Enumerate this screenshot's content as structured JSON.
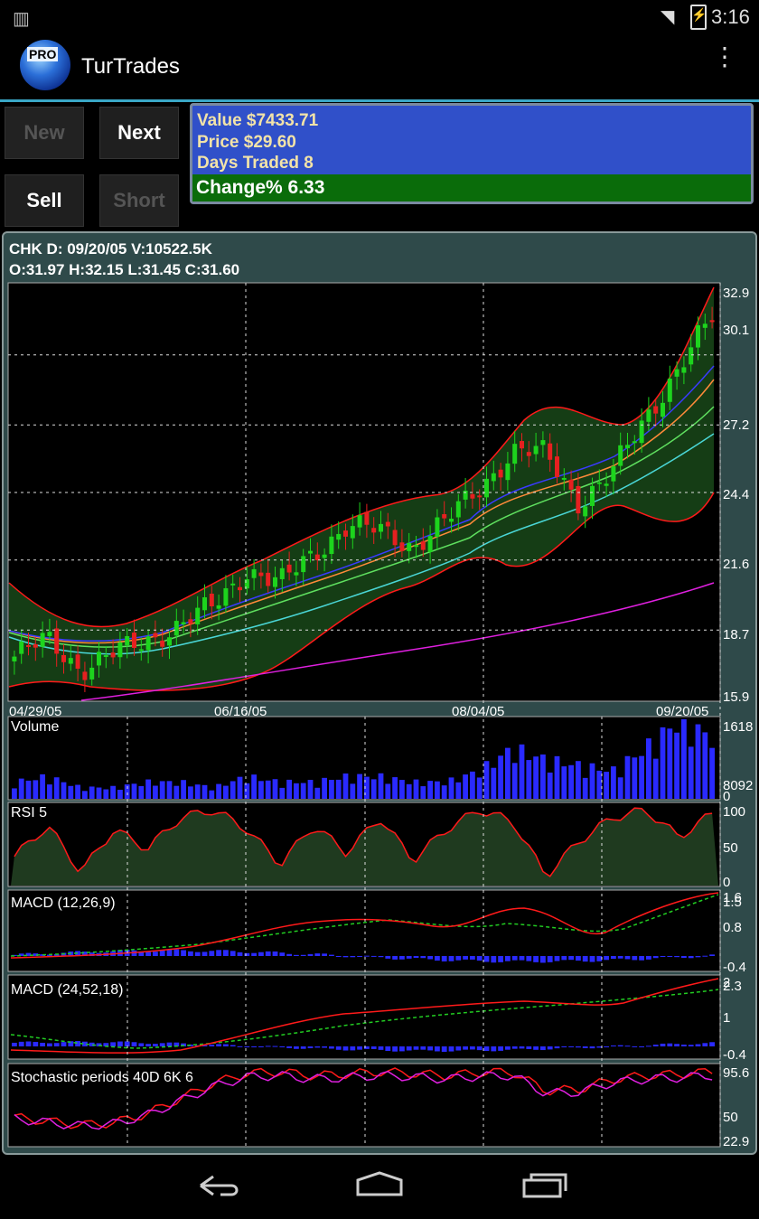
{
  "status_bar": {
    "time": "3:16"
  },
  "action_bar": {
    "title": "TurTrades",
    "logo_text": "PRO"
  },
  "buttons": {
    "new": "New",
    "next": "Next",
    "sell": "Sell",
    "short": "Short"
  },
  "info": {
    "value": "Value  $7433.71",
    "price": "Price   $29.60",
    "days": "Days Traded 8",
    "change": "Change% 6.33"
  },
  "quote": {
    "line1": "CHK D: 09/20/05 V:10522.5K",
    "line2": "O:31.97 H:32.15 L:31.45 C:31.60"
  },
  "panels": {
    "price": {
      "yticks": [
        "32.9",
        "30.1",
        "27.2",
        "24.4",
        "21.6",
        "18.7",
        "15.9"
      ],
      "xticks": [
        "04/29/05",
        "06/16/05",
        "08/04/05",
        "09/20/05"
      ]
    },
    "volume": {
      "label": "Volume",
      "yticks": [
        "1618",
        "8092",
        "0"
      ]
    },
    "rsi": {
      "label": "RSI 5",
      "yticks": [
        "100",
        "50",
        "0"
      ]
    },
    "macd1": {
      "label": "MACD (12,26,9)",
      "yticks": [
        "1.6",
        "1.5",
        "0.8",
        "-0.4"
      ]
    },
    "macd2": {
      "label": "MACD (24,52,18)",
      "yticks": [
        "2",
        "2.3",
        "1",
        "-0.4"
      ]
    },
    "stoch": {
      "label": "Stochastic periods 40D 6K 6",
      "yticks": [
        "95.6",
        "50",
        "22.9"
      ]
    }
  },
  "colors": {
    "up": "#1dd41d",
    "down": "#e62020",
    "bollinger": "#ff1a1a",
    "ma_long": "#e020e0",
    "volume": "#2a2aff",
    "macd_signal": "#22cc22"
  },
  "chart_data": {
    "type": "candlestick",
    "title": "CHK D: 09/20/05 V:10522.5K",
    "x_range": [
      "04/29/05",
      "09/20/05"
    ],
    "ylim": [
      15.9,
      32.9
    ],
    "close_trend": [
      {
        "x": "04/29/05",
        "y": 17.6
      },
      {
        "x": "05/05/05",
        "y": 18.3
      },
      {
        "x": "05/11/05",
        "y": 17.1
      },
      {
        "x": "05/17/05",
        "y": 17.7
      },
      {
        "x": "05/24/05",
        "y": 18.3
      },
      {
        "x": "05/31/05",
        "y": 18.9
      },
      {
        "x": "06/07/05",
        "y": 19.7
      },
      {
        "x": "06/16/05",
        "y": 21.2
      },
      {
        "x": "06/23/05",
        "y": 20.6
      },
      {
        "x": "06/30/05",
        "y": 21.9
      },
      {
        "x": "07/07/05",
        "y": 23.0
      },
      {
        "x": "07/14/05",
        "y": 22.8
      },
      {
        "x": "07/21/05",
        "y": 22.2
      },
      {
        "x": "07/28/05",
        "y": 23.2
      },
      {
        "x": "08/04/05",
        "y": 24.6
      },
      {
        "x": "08/10/05",
        "y": 26.1
      },
      {
        "x": "08/17/05",
        "y": 26.0
      },
      {
        "x": "08/24/05",
        "y": 24.0
      },
      {
        "x": "08/31/05",
        "y": 25.2
      },
      {
        "x": "09/07/05",
        "y": 27.5
      },
      {
        "x": "09/13/05",
        "y": 29.6
      },
      {
        "x": "09/20/05",
        "y": 31.6
      }
    ],
    "volume_trend": [
      3,
      4,
      2,
      2,
      3,
      3,
      2,
      4,
      3,
      3,
      4,
      4,
      3,
      3,
      5,
      9,
      7,
      6,
      5,
      9,
      14,
      11
    ],
    "rsi_trend": [
      35,
      75,
      15,
      70,
      45,
      85,
      95,
      70,
      25,
      75,
      40,
      85,
      30,
      70,
      95,
      80,
      10,
      55,
      85,
      95,
      60,
      90
    ],
    "stochastic_trend": [
      35,
      30,
      25,
      28,
      40,
      60,
      80,
      93,
      95,
      90,
      92,
      95,
      93,
      90,
      94,
      95,
      70,
      72,
      85,
      90,
      92,
      95
    ]
  }
}
